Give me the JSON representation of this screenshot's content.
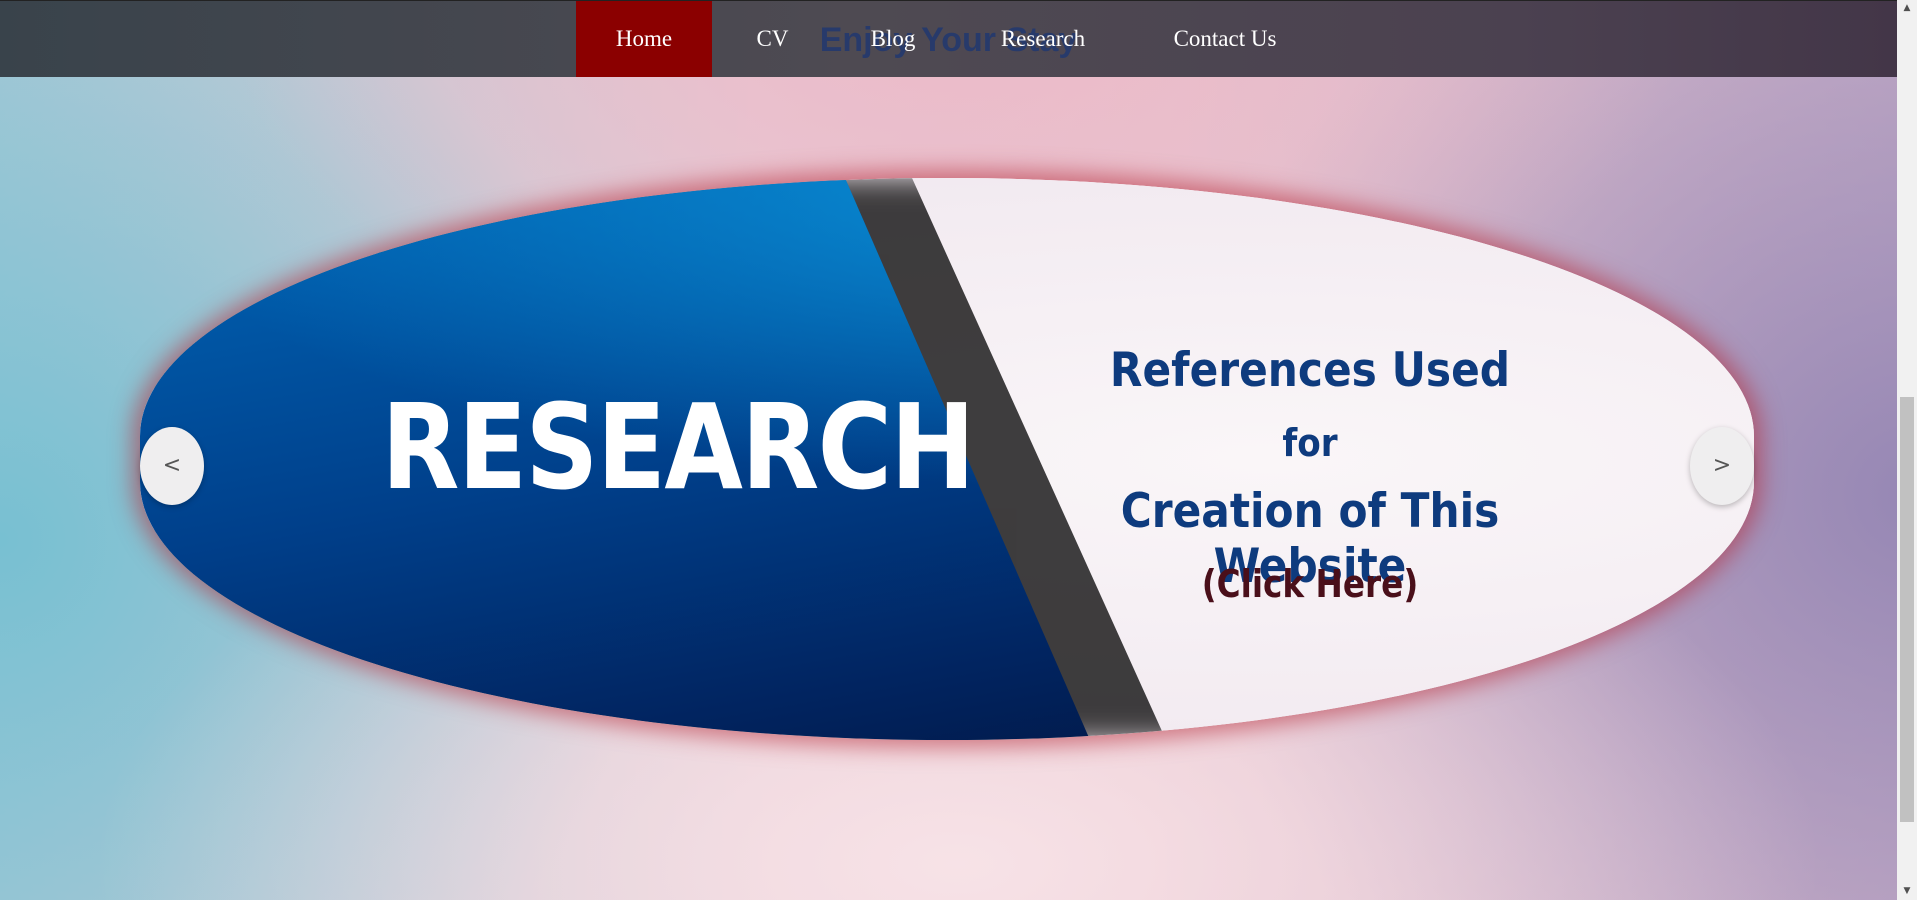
{
  "header": {
    "background_title": "Enjoy Your Stay",
    "nav": [
      {
        "label": "Home",
        "active": true
      },
      {
        "label": "CV",
        "active": false
      },
      {
        "label": "Blog",
        "active": false
      },
      {
        "label": "Research",
        "active": false
      },
      {
        "label": "Contact Us",
        "active": false
      }
    ]
  },
  "slider": {
    "left_heading": "RESEARCH",
    "right_lines": [
      "References Used",
      "for",
      "Creation of This Website",
      "(Click Here)"
    ],
    "prev_label": "<",
    "next_label": ">"
  },
  "scrollbar": {
    "up_glyph": "▲",
    "down_glyph": "▼"
  },
  "colors": {
    "nav_active": "#8b0000",
    "slide_blue": "#003f8a",
    "heading_text": "#0e3b7e",
    "link_text": "#4a0f1a",
    "frame_glow": "#b42837"
  }
}
